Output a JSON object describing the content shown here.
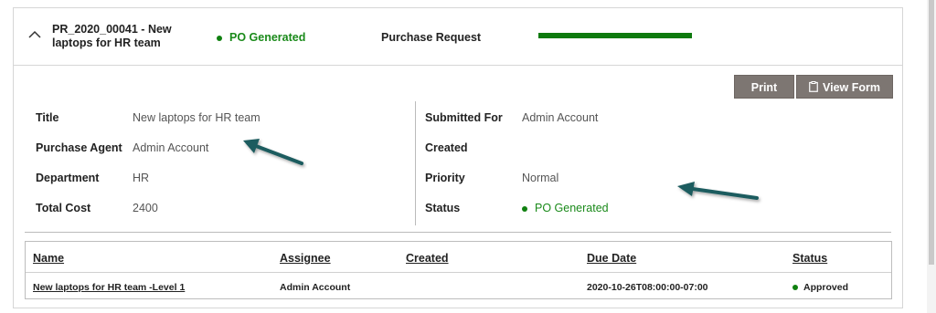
{
  "header": {
    "request_title": "PR_2020_00041 - New laptops for HR team",
    "status": "PO Generated",
    "request_type": "Purchase Request",
    "progress": 1.0,
    "progress_color": "#0e7a0e"
  },
  "toolbar": {
    "print_label": "Print",
    "view_form_label": "View Form"
  },
  "details_left": {
    "title_label": "Title",
    "title_value": "New laptops for HR team",
    "agent_label": "Purchase Agent",
    "agent_value": "Admin Account",
    "department_label": "Department",
    "department_value": "HR",
    "total_cost_label": "Total Cost",
    "total_cost_value": "2400"
  },
  "details_right": {
    "submitted_for_label": "Submitted For",
    "submitted_for_value": "Admin Account",
    "created_label": "Created",
    "created_value": "",
    "priority_label": "Priority",
    "priority_value": "Normal",
    "status_label": "Status",
    "status_value": "PO Generated"
  },
  "approvals": {
    "columns": [
      "Name",
      "Assignee",
      "Created",
      "Due Date",
      "Status"
    ],
    "rows": [
      {
        "name": "New laptops for HR team -Level 1",
        "assignee": "Admin Account",
        "created": "",
        "due_date": "2020-10-26T08:00:00-07:00",
        "status": "Approved"
      }
    ]
  },
  "colors": {
    "status_green": "#108010",
    "button_bg": "#7d7672",
    "arrow_color": "#1f5c5f"
  }
}
